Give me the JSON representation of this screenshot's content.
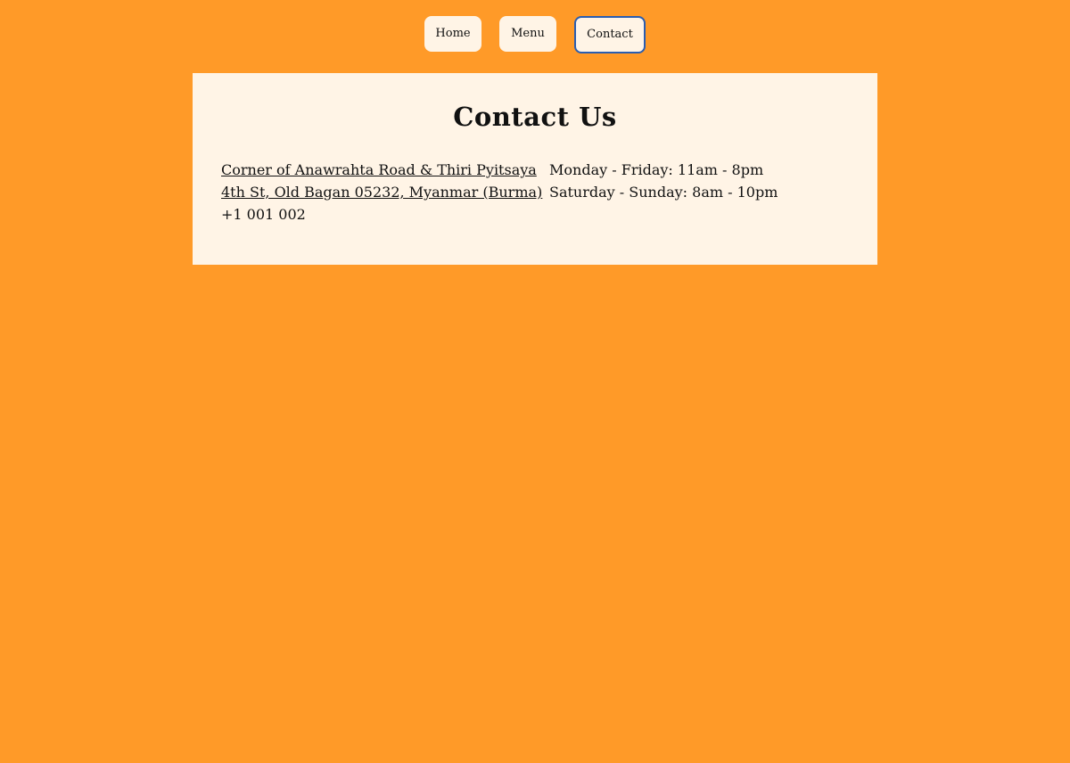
{
  "nav": {
    "items": [
      {
        "label": "Home"
      },
      {
        "label": "Menu"
      },
      {
        "label": "Contact"
      }
    ]
  },
  "contact": {
    "title": "Contact Us",
    "address_line1": "Corner of Anawrahta Road & Thiri Pyitsaya",
    "address_line2": "4th St, Old Bagan 05232, Myanmar (Burma)",
    "phone": "+1 001 002",
    "hours": [
      "Monday - Friday: 11am - 8pm",
      "Saturday - Sunday: 8am - 10pm"
    ]
  },
  "colors": {
    "background": "#ff9a28",
    "card": "#fff4e6",
    "active_border": "#2a5db0"
  }
}
